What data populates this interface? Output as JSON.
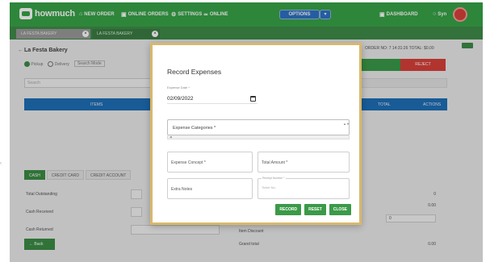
{
  "navbar": {
    "logo_text": "howmuch",
    "links": [
      {
        "icon": "home-icon",
        "glyph": "⌂",
        "label": "NEW ORDER"
      },
      {
        "icon": "cart-icon",
        "glyph": "▣",
        "label": "ONLINE ORDERS"
      },
      {
        "icon": "gear-icon",
        "glyph": "⚙",
        "label": "SETTINGS"
      },
      {
        "icon": "wifi-icon",
        "glyph": "≃",
        "label": "ONLINE"
      }
    ],
    "options_label": "OPTIONS",
    "options_caret": "▾",
    "dashboard_label": "DASHBOARD",
    "user_label": "Syn",
    "accent_color": "#38a447"
  },
  "order_tabs": [
    {
      "label": "LA FESTA BAKERY",
      "active": false,
      "close": "×"
    },
    {
      "label": "LA FESTA BAKERY",
      "active": true,
      "close": "×"
    }
  ],
  "background": {
    "customer_name": "La Festa Bakery",
    "back_arrow": "←",
    "radio_a": "Pickup",
    "radio_b": "Delivery",
    "search_mode": "Search Mode",
    "search_placeholder": "Search",
    "table_headers": [
      "ITEMS",
      "TOTAL",
      "ACTIONS"
    ],
    "header_summary": "ORDER NO: 7 14:31:26  TOTAL: $0.00",
    "reject_label": "REJECT",
    "payment_tabs": [
      "CASH",
      "CREDIT CARD",
      "CREDIT ACCOUNT"
    ],
    "labels": [
      "Total Outstanding",
      "Cash Received",
      "Cash Returned"
    ],
    "right_values": [
      "0",
      "0.00",
      "0",
      "0.00"
    ],
    "right_labels": [
      "Item Discount",
      "Grand total"
    ],
    "back_label": "← Back"
  },
  "modal": {
    "title": "Record Expenses",
    "date_label": "Expense Date *",
    "date_value": "02/09/2022",
    "category_placeholder": "Expense Categories *",
    "category_scroll": "▲▼",
    "category_hscroll": "◀",
    "fields": [
      {
        "name": "expense-concept-field",
        "label": "Expense Concept *"
      },
      {
        "name": "total-amount-field",
        "label": "Total Amount *"
      },
      {
        "name": "extra-notes-field",
        "label": "Extra Notes"
      },
      {
        "name": "receipt-number-field",
        "label": "Receipt Number *",
        "placeholder": "Ticket No."
      }
    ],
    "buttons": [
      "RECORD",
      "RESET",
      "CLOSE"
    ],
    "button_color": "#3b9a48"
  },
  "page_mark": "‹"
}
